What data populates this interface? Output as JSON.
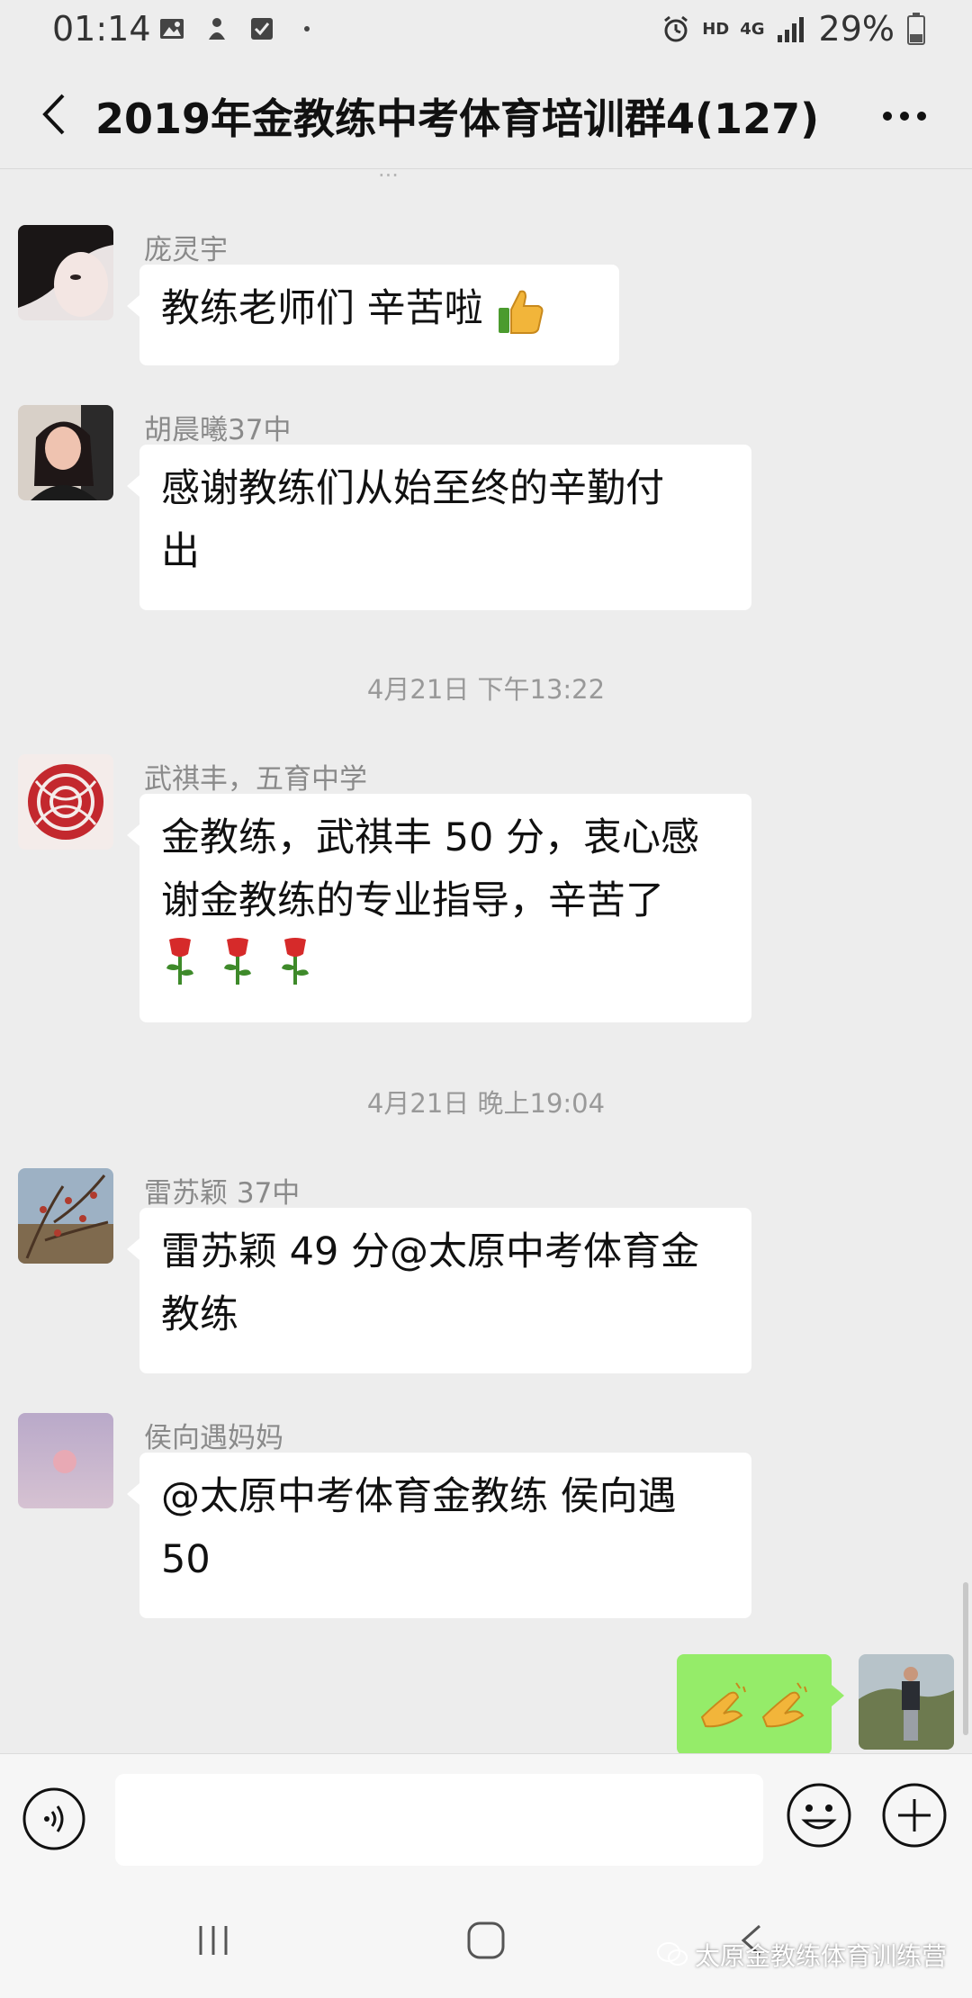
{
  "status_bar": {
    "time": "01:14",
    "network_hd": "HD",
    "network_4g": "4G",
    "battery_percent": "29%"
  },
  "header": {
    "title": "2019年金教练中考体育培训群4(127)"
  },
  "chat": {
    "cut_off_text": "...",
    "messages": [
      {
        "sender": "庞灵宇",
        "text": "教练老师们   辛苦啦",
        "emoji": "thumbs-up-icon"
      },
      {
        "sender": "胡晨曦37中",
        "line1": "感谢教练们从始至终的辛勤付",
        "line2": "出"
      },
      {
        "sender": "武祺丰，五育中学",
        "line1": "金教练，武祺丰 50 分，衷心感",
        "line2": "谢金教练的专业指导，辛苦了",
        "emoji": "rose-icon"
      },
      {
        "sender": "雷苏颖 37中",
        "line1": "雷苏颖 49 分@太原中考体育金",
        "line2": "教练"
      },
      {
        "sender": "侯向遇妈妈",
        "line1": "@太原中考体育金教练   侯向遇",
        "line2": "50"
      }
    ],
    "timestamps": [
      "4月21日 下午13:22",
      "4月21日 晚上19:04"
    ],
    "my_message": {
      "emoji": "clapping-hands-icon"
    }
  },
  "watermark": {
    "text": "太原金教练体育训练营"
  },
  "colors": {
    "background": "#ededed",
    "bubble_received": "#ffffff",
    "bubble_sent": "#95ec69"
  }
}
